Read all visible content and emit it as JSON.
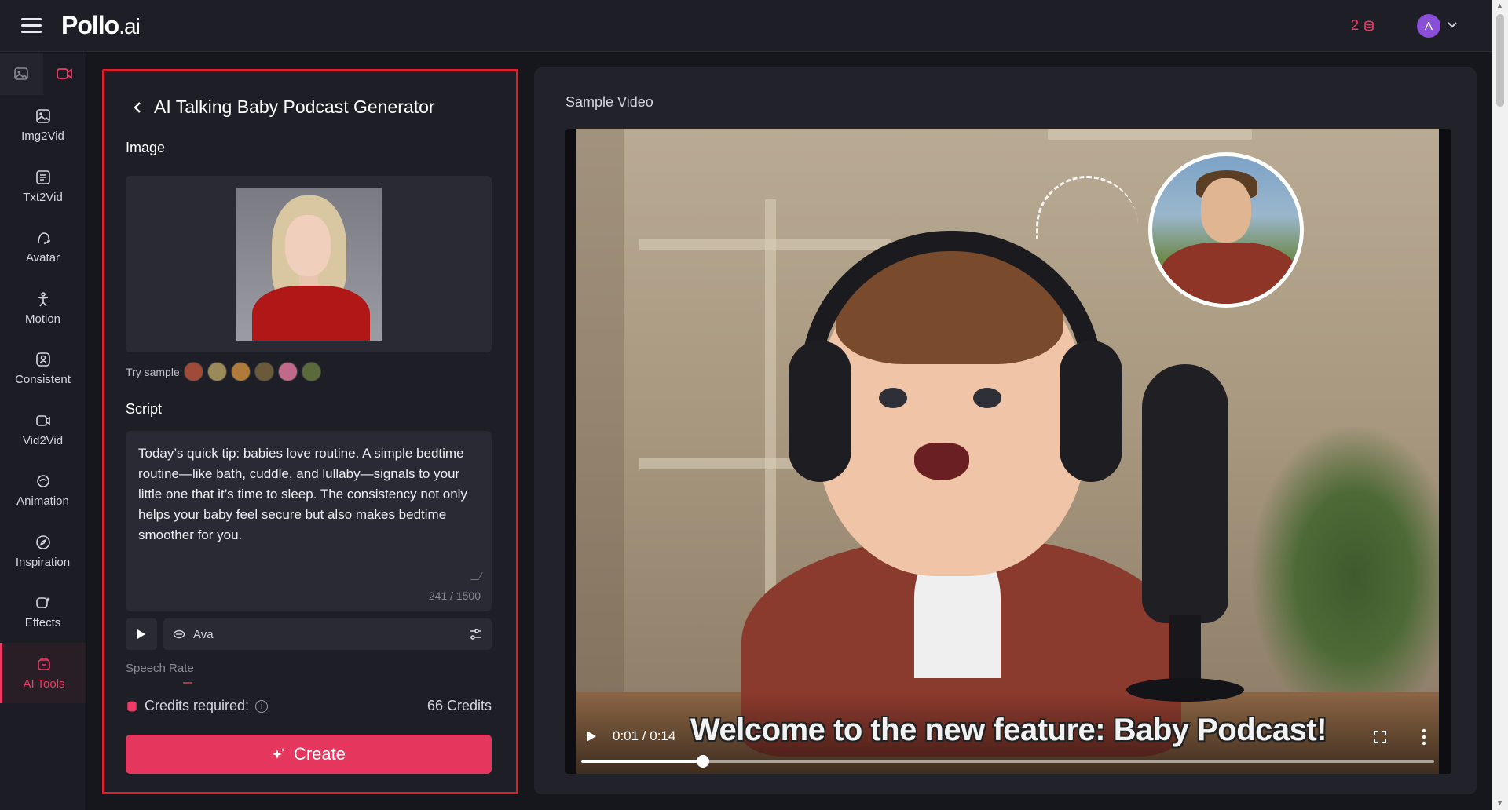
{
  "header": {
    "logo_main": "Pollo",
    "logo_domain": ".ai",
    "credits_count": "2",
    "avatar_initial": "A"
  },
  "sidebar": {
    "tabs": [
      {
        "name": "image-tab",
        "icon": "image-icon",
        "active": false
      },
      {
        "name": "video-tab",
        "icon": "video-camera-icon",
        "active": true
      }
    ],
    "items": [
      {
        "label": "Img2Vid",
        "icon": "image-to-video-icon"
      },
      {
        "label": "Txt2Vid",
        "icon": "text-to-video-icon"
      },
      {
        "label": "Avatar",
        "icon": "avatar-icon"
      },
      {
        "label": "Motion",
        "icon": "motion-icon"
      },
      {
        "label": "Consistent",
        "icon": "consistent-icon"
      },
      {
        "label": "Vid2Vid",
        "icon": "video-to-video-icon"
      },
      {
        "label": "Animation",
        "icon": "animation-icon"
      },
      {
        "label": "Inspiration",
        "icon": "compass-icon"
      },
      {
        "label": "Effects",
        "icon": "effects-icon"
      },
      {
        "label": "AI Tools",
        "icon": "ai-tools-icon",
        "active": true
      }
    ],
    "accent_color": "#ee3a64"
  },
  "panel": {
    "title": "AI Talking Baby Podcast Generator",
    "image_label": "Image",
    "try_sample_label": "Try sample",
    "script_label": "Script",
    "script_text": "Today’s quick tip: babies love routine. A simple bedtime routine—like bath, cuddle, and lullaby—signals to your little one that it’s time to sleep. The consistency not only helps your baby feel secure but also makes bedtime smoother for you.",
    "char_count": "241 / 1500",
    "voice_name": "Ava",
    "speech_rate_label": "Speech Rate",
    "credits_required_label": "Credits required:",
    "credits_value": "66 Credits",
    "create_label": "Create",
    "highlight_border_color": "#e0202e",
    "button_color": "#e5365e"
  },
  "video": {
    "section_label": "Sample Video",
    "time_display": "0:01 / 0:14",
    "subtitle": "Welcome to the new feature: Baby Podcast!",
    "progress_fraction": 0.143
  }
}
